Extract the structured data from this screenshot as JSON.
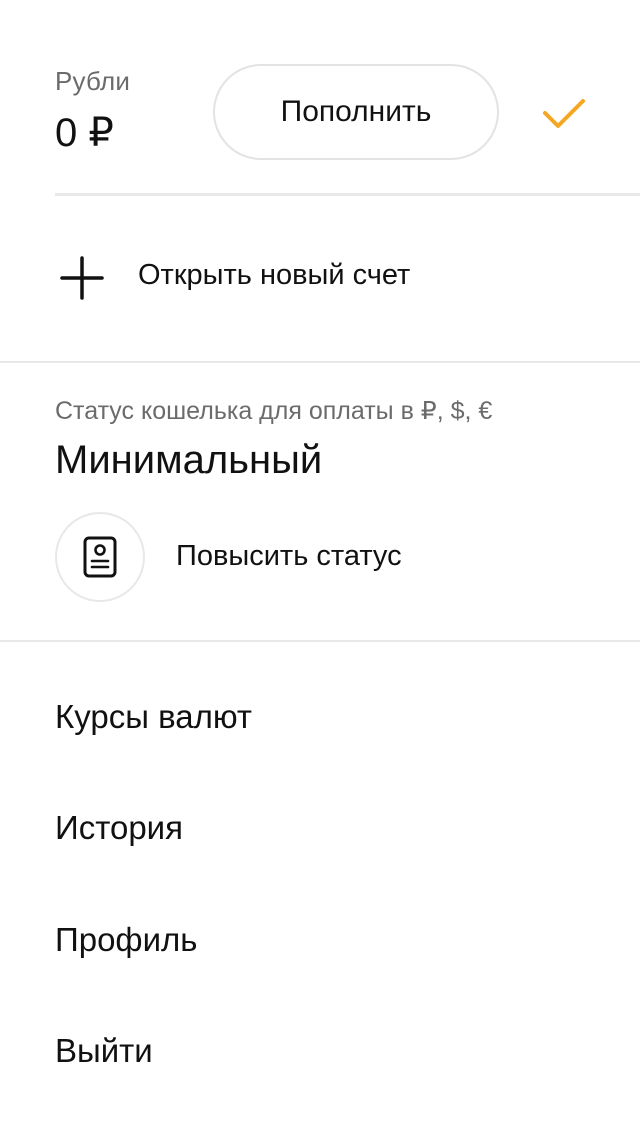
{
  "account": {
    "label": "Рубли",
    "balance": "0 ₽",
    "topup_label": "Пополнить",
    "selected_icon": "check-icon",
    "accent_color": "#F5A623"
  },
  "open_account": {
    "icon": "plus-icon",
    "label": "Открыть новый счет"
  },
  "wallet_status": {
    "caption": "Статус кошелька для оплаты в ₽, $, €",
    "value": "Минимальный",
    "raise_icon": "id-card-icon",
    "raise_label": "Повысить статус"
  },
  "menu": {
    "rates": "Курсы валют",
    "history": "История",
    "profile": "Профиль",
    "logout": "Выйти"
  }
}
